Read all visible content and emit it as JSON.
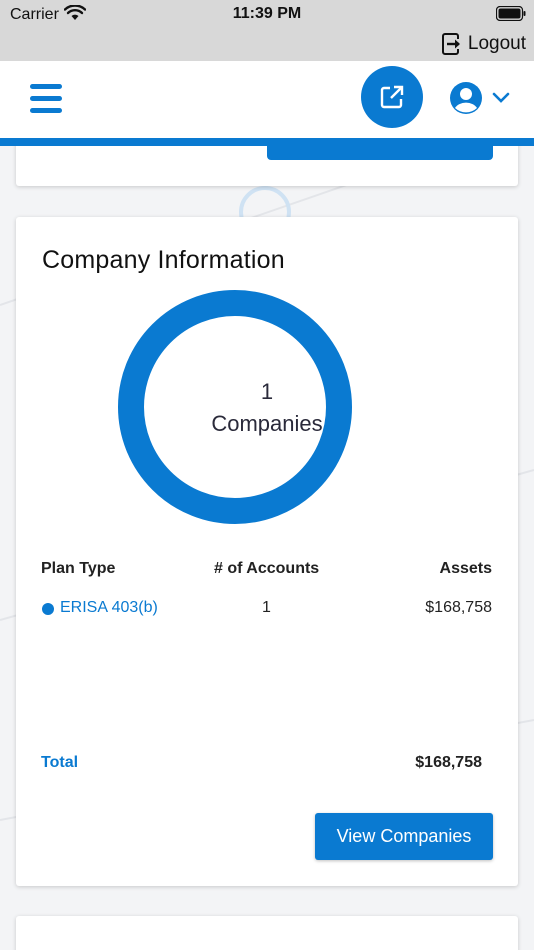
{
  "status": {
    "carrier": "Carrier",
    "time": "11:39 PM"
  },
  "topbar": {
    "logout_label": "Logout"
  },
  "company_card": {
    "title": "Company Information",
    "donut": {
      "count": "1",
      "label": "Companies",
      "color": "#0a7ad1"
    },
    "table": {
      "headers": {
        "plan_type": "Plan Type",
        "accounts": "# of Accounts",
        "assets": "Assets"
      },
      "rows": [
        {
          "plan_type": "ERISA 403(b)",
          "accounts": "1",
          "assets": "$168,758",
          "color": "#0a7ad1"
        }
      ]
    },
    "total": {
      "label": "Total",
      "value": "$168,758"
    },
    "view_button": "View Companies"
  },
  "colors": {
    "primary": "#0a7ad1",
    "background": "#f3f4f6"
  }
}
